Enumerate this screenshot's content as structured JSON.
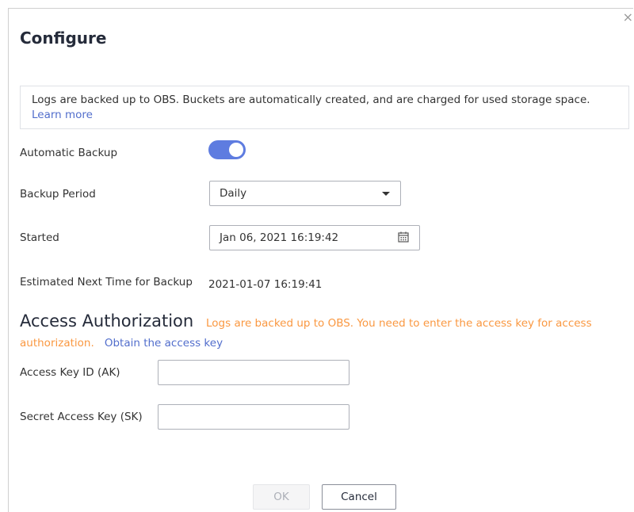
{
  "dialog": {
    "title": "Configure",
    "close_glyph": "×"
  },
  "notice": {
    "text": "Logs are backed up to OBS. Buckets are automatically created, and are charged for used storage space.",
    "learn_more": "Learn more"
  },
  "automatic_backup": {
    "label": "Automatic Backup",
    "enabled": true
  },
  "backup_period": {
    "label": "Backup Period",
    "value": "Daily"
  },
  "started": {
    "label": "Started",
    "value": "Jan 06, 2021 16:19:42"
  },
  "next_backup": {
    "label": "Estimated Next Time for Backup",
    "value": "2021-01-07 16:19:41"
  },
  "access": {
    "title": "Access Authorization",
    "warning_line1": "Logs are backed up to OBS. You need to enter the access key for access",
    "warning_line2": "authorization.",
    "obtain_link": "Obtain the access key",
    "ak_label": "Access Key ID (AK)",
    "ak_value": "",
    "sk_label": "Secret Access Key (SK)",
    "sk_value": ""
  },
  "buttons": {
    "ok": "OK",
    "cancel": "Cancel"
  },
  "colors": {
    "accent": "#5e7ce0",
    "link": "#526ecc",
    "warning": "#fa9841"
  }
}
